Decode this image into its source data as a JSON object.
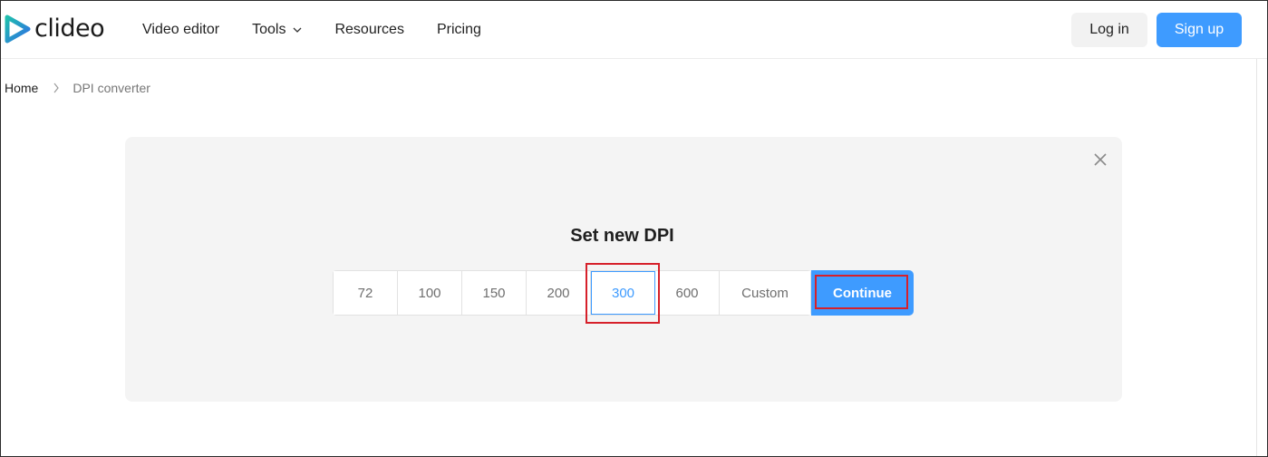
{
  "header": {
    "logo_text": "clideo",
    "nav": [
      {
        "label": "Video editor"
      },
      {
        "label": "Tools",
        "has_dropdown": true
      },
      {
        "label": "Resources"
      },
      {
        "label": "Pricing"
      }
    ],
    "login_label": "Log in",
    "signup_label": "Sign up"
  },
  "breadcrumb": {
    "home": "Home",
    "current": "DPI converter"
  },
  "panel": {
    "title": "Set new DPI",
    "options": [
      "72",
      "100",
      "150",
      "200",
      "300",
      "600",
      "Custom"
    ],
    "selected": "300",
    "continue_label": "Continue"
  },
  "colors": {
    "accent": "#3e9bff",
    "panel_bg": "#f4f4f4",
    "highlight": "#d6202a",
    "logo_teal": "#1fbfae",
    "logo_blue": "#2f6fe4"
  },
  "icons": [
    "clideo-logo-icon",
    "chevron-down-icon",
    "chevron-right-icon",
    "close-icon"
  ]
}
